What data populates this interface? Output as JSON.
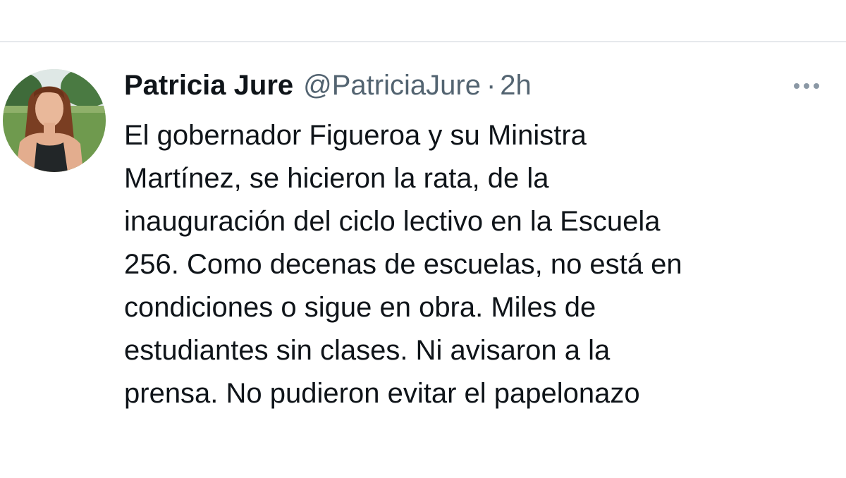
{
  "tweet": {
    "author": {
      "display_name": "Patricia Jure",
      "handle": "@PatriciaJure",
      "avatar_icon": "profile-photo"
    },
    "separator": "·",
    "time": "2h",
    "more_icon": "more-options-icon",
    "text_lines": [
      "El gobernador Figueroa y su Ministra",
      "Martínez, se hicieron la rata, de la",
      "inauguración del ciclo lectivo en la Escuela",
      "256. Como decenas de escuelas, no está en",
      "condiciones o sigue en obra. Miles de",
      "estudiantes sin clases. Ni avisaron a la",
      "prensa. No pudieron evitar el papelonazo"
    ]
  },
  "colors": {
    "text_primary": "#0f1419",
    "text_secondary": "#536471",
    "divider": "#e6e9ec"
  }
}
